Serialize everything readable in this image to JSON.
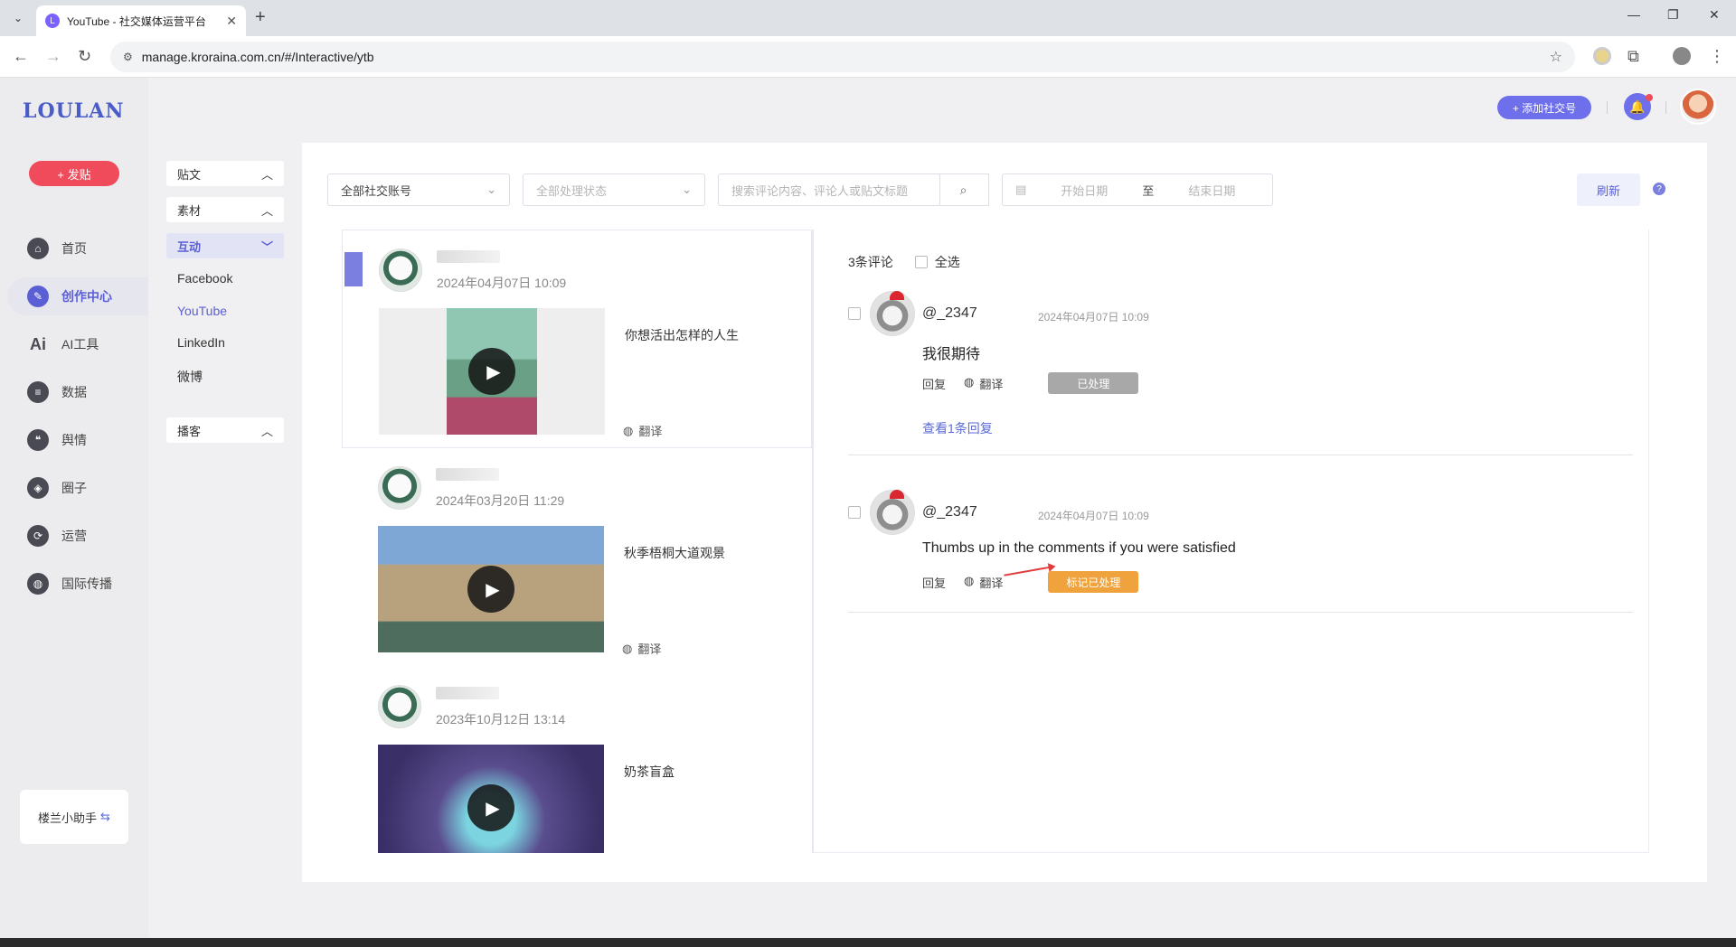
{
  "browser": {
    "tab_title": "YouTube - 社交媒体运营平台",
    "url": "manage.kroraina.com.cn/#/Interactive/ytb"
  },
  "app": {
    "logo": "LOULAN",
    "post_button": "+ 发贴",
    "menu": [
      "首页",
      "创作中心",
      "AI工具",
      "数据",
      "舆情",
      "圈子",
      "运营",
      "国际传播"
    ],
    "menu_icons": [
      "home-icon",
      "palette-icon",
      "ai-icon",
      "database-icon",
      "quote-icon",
      "compass-icon",
      "cycle-icon",
      "globe-icon"
    ],
    "helper": "楼兰小助手",
    "add_social": "+ 添加社交号"
  },
  "subnav": {
    "groups": [
      "贴文",
      "素材",
      "互动",
      "播客"
    ],
    "items": [
      "Facebook",
      "YouTube",
      "LinkedIn",
      "微博"
    ]
  },
  "filters": {
    "account": "全部社交账号",
    "status": "全部处理状态",
    "search_placeholder": "搜索评论内容、评论人或贴文标题",
    "start_date": "开始日期",
    "separator": "至",
    "end_date": "结束日期",
    "refresh": "刷新"
  },
  "posts": [
    {
      "date": "2024年04月07日 10:09",
      "title": "你想活出怎样的人生",
      "translate": "翻译"
    },
    {
      "date": "2024年03月20日 11:29",
      "title": "秋季梧桐大道观景",
      "translate": "翻译"
    },
    {
      "date": "2023年10月12日 13:14",
      "title": "奶茶盲盒",
      "translate": "翻译"
    }
  ],
  "comments_panel": {
    "count": "3条评论",
    "select_all": "全选",
    "comments": [
      {
        "user": "@_2347",
        "time": "2024年04月07日 10:09",
        "text": "我很期待",
        "reply": "回复",
        "translate": "翻译",
        "status": "已处理",
        "view_replies": "查看1条回复"
      },
      {
        "user": "@_2347",
        "time": "2024年04月07日 10:09",
        "text": "Thumbs up in the comments if you were satisfied",
        "reply": "回复",
        "translate": "翻译",
        "status": "标记已处理"
      }
    ]
  },
  "colors": {
    "brand": "#5b5fd6",
    "post_button": "#f04b5a",
    "mark_processed": "#f0a23c",
    "processed": "#a8a8a8"
  }
}
